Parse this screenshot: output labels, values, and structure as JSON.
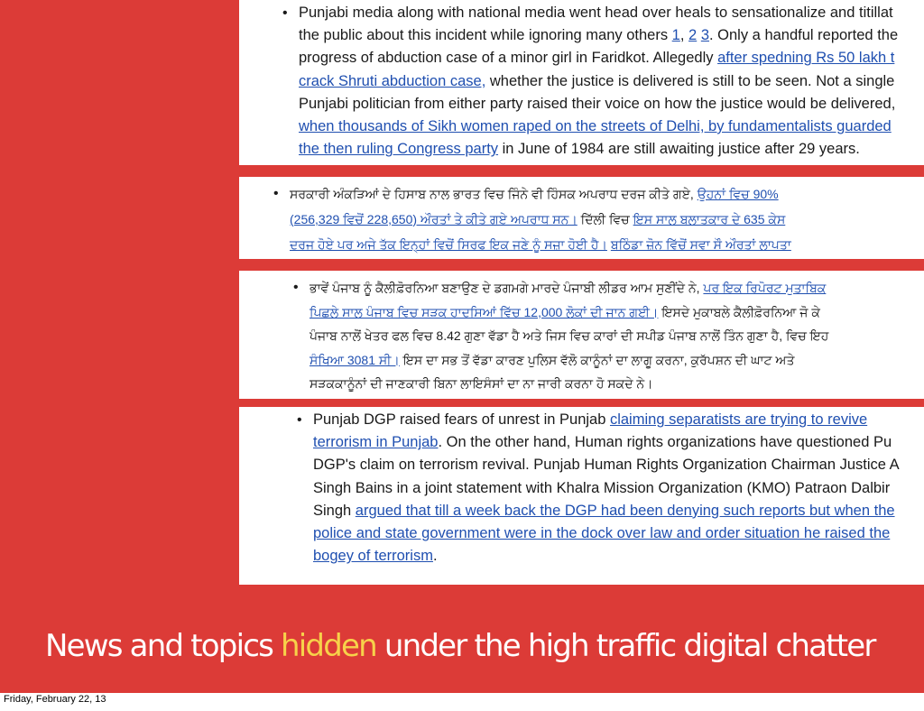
{
  "panels": [
    {
      "lines": [
        {
          "text": "Punjabi media along with national media went head over heals to sensationalize and titillat"
        },
        {
          "parts": [
            {
              "t": "the public about this incident while ignoring many others "
            },
            {
              "t": "1",
              "link": true
            },
            {
              "t": ", "
            },
            {
              "t": "2",
              "link": true
            },
            {
              "t": " "
            },
            {
              "t": "3",
              "link": true
            },
            {
              "t": ". Only a handful reported the"
            }
          ]
        },
        {
          "parts": [
            {
              "t": "progress of abduction case of a minor girl in Faridkot. Allegedly "
            },
            {
              "t": "after spedning Rs 50 lakh t",
              "link": true
            }
          ]
        },
        {
          "parts": [
            {
              "t": "crack Shruti abduction case,",
              "link": true
            },
            {
              "t": " whether the justice is delivered is still to be seen. Not a single"
            }
          ]
        },
        {
          "text": "Punjabi politician from either party raised their voice on how the justice would be delivered,"
        },
        {
          "parts": [
            {
              "t": "when thousands of Sikh women raped on the streets of Delhi, by fundamentalists guarded",
              "link": true
            }
          ]
        },
        {
          "parts": [
            {
              "t": "the then ruling Congress party",
              "link": true
            },
            {
              "t": " in June of 1984 are still awaiting justice after 29 years."
            }
          ]
        }
      ]
    },
    {
      "lines": [
        {
          "parts": [
            {
              "t": "ਸਰਕਾਰੀ ਅੰਕੜਿਆਂ ਦੇ ਹਿਸਾਬ ਨਾਲ ਭਾਰਤ ਵਿਚ ਜਿੰਨੇ ਵੀ ਹਿੰਸਕ ਅਪਰਾਧ ਦਰਜ ਕੀਤੇ ਗਏ, "
            },
            {
              "t": "ਉਹਨਾਂ ਵਿਚ 90%",
              "link": true
            }
          ]
        },
        {
          "parts": [
            {
              "t": "(256,329 ਵਿਚੋਂ 228,650) ਔਰਤਾਂ ਤੇ ਕੀਤੇ ਗਏ ਅਪਰਾਧ ਸਨ।",
              "link": true
            },
            {
              "t": " ਦਿੱਲੀ ਵਿਚ "
            },
            {
              "t": "ਇਸ ਸਾਲ ਬਲਾਤਕਾਰ ਦੇ 635 ਕੇਸ",
              "link": true
            }
          ]
        },
        {
          "parts": [
            {
              "t": "ਦਰਜ ਹੋਏ ਪਰ ਅਜੇ ਤੱਕ ਇਨ੍ਹਾਂ ਵਿਚੋਂ ਸਿਰਫ ਇਕ ਜਣੇ ਨੂੰ ਸਜ਼ਾ ਹੋਈ ਹੈ।",
              "link": true
            },
            {
              "t": " "
            },
            {
              "t": "ਬਠਿੰਡਾ ਜ਼ੋਨ ਵਿੱਚੋਂ ਸਵਾ ਸੌ ਔਰਤਾਂ ਲਾਪਤਾ",
              "link": true
            }
          ]
        }
      ]
    },
    {
      "lines": [
        {
          "parts": [
            {
              "t": "ਭਾਵੇਂ ਪੰਜਾਬ ਨੂੰ ਕੈਲੀਫ਼ੋਰਨਿਆ ਬਣਾਉਣ ਦੇ ਡਗਮਗੇ ਮਾਰਦੇ ਪੰਜਾਬੀ ਲੀਡਰ ਆਮ ਸੁਣੀਂਦੇ ਨੇ, "
            },
            {
              "t": "ਪਰ ਇਕ ਰਿਪੋਰਟ ਮੁਤਾਬਿਕ",
              "link": true
            }
          ]
        },
        {
          "parts": [
            {
              "t": "ਪਿਛਲੇ ਸਾਲ ਪੰਜਾਬ ਵਿਚ ਸੜਕ ਹਾਦਸਿਆਂ ਵਿੱਚ 12,000 ਲੋਕਾਂ ਦੀ ਜਾਨ ਗਈ।",
              "link": true
            },
            {
              "t": " ਇਸਦੇ ਮੁਕਾਬਲੇ ਕੈਲੀਫ਼ੋਰਨਿਆ ਜੋ ਕੇ"
            }
          ]
        },
        {
          "text": "ਪੰਜਾਬ ਨਾਲੋਂ ਖੇਤਰ ਫਲ ਵਿਚ 8.42 ਗੁਣਾ ਵੱਡਾ ਹੈ ਅਤੇ ਜਿਸ ਵਿਚ ਕਾਰਾਂ ਦੀ ਸਪੀਡ ਪੰਜਾਬ ਨਾਲੋਂ ਤਿੰਨ ਗੁਣਾ ਹੈ, ਵਿਚ ਇਹ"
        },
        {
          "parts": [
            {
              "t": "ਸੰਖਿਆ 3081 ਸੀ।",
              "link": true
            },
            {
              "t": " ਇਸ ਦਾ ਸਭ ਤੋਂ ਵੱਡਾ ਕਾਰਣ ਪੁਲਿਸ ਵੱਲੋ ਕਾਨੂੰਨਾਂ ਦਾ ਲਾਗੂ ਕਰਨਾ, ਕੁਰੱਪਸ਼ਨ ਦੀ ਘਾਟ ਅਤੇ"
            }
          ]
        },
        {
          "text": "ਸੜਕਕਾਨੂੰਨਾਂ ਦੀ ਜਾਣਕਾਰੀ ਬਿਨਾ ਲਾਇਸੰਸਾਂ ਦਾ ਨਾ ਜਾਰੀ ਕਰਨਾ ਹੋ ਸਕਦੇ ਨੇ।"
        }
      ]
    },
    {
      "lines": [
        {
          "parts": [
            {
              "t": "Punjab DGP raised fears of unrest in Punjab "
            },
            {
              "t": "claiming separatists are trying to revive",
              "link": true
            }
          ]
        },
        {
          "parts": [
            {
              "t": "terrorism in Punjab",
              "link": true
            },
            {
              "t": ". On the other hand, Human rights organizations have questioned Pu"
            }
          ]
        },
        {
          "text": "DGP's claim on terrorism revival. Punjab Human Rights Organization Chairman Justice A"
        },
        {
          "text": "Singh Bains in a joint statement with Khalra Mission Organization (KMO) Patraon Dalbir"
        },
        {
          "parts": [
            {
              "t": "Singh "
            },
            {
              "t": "argued that till a week back the DGP had been denying such reports but when the",
              "link": true
            }
          ]
        },
        {
          "parts": [
            {
              "t": "police and state government were in the dock over law and order situation he raised the",
              "link": true
            }
          ]
        },
        {
          "parts": [
            {
              "t": "bogey of terrorism",
              "link": true
            },
            {
              "t": "."
            }
          ]
        }
      ]
    }
  ],
  "caption": {
    "before": "News and topics ",
    "highlight": "hidden",
    "after": " under the high traffic digital chatter"
  },
  "footer": "Friday, February 22, 13",
  "colors": {
    "background": "#dc3b37",
    "highlight": "#f7d24a",
    "link": "#1f4fb0"
  }
}
